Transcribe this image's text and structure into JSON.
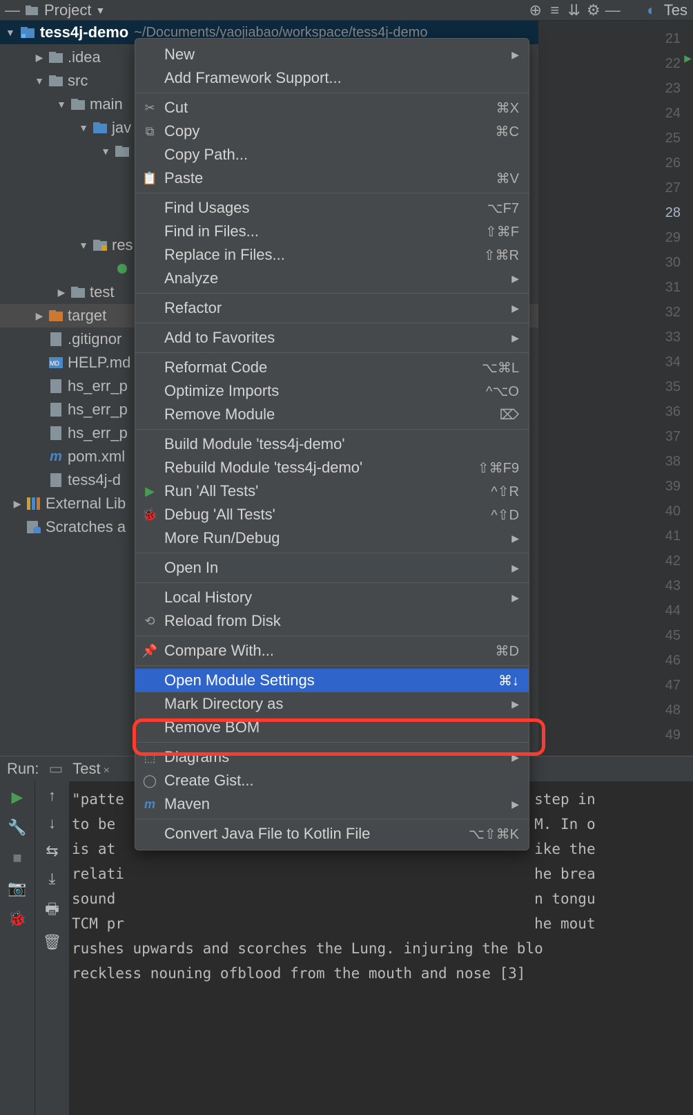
{
  "toolbar": {
    "project_label": "Project",
    "right_tab": "Tes"
  },
  "project_tree": {
    "root_name": "tess4j-demo",
    "root_path": "~/Documents/yaojiabao/workspace/tess4j-demo",
    "items": [
      {
        "label": ".idea",
        "depth": 1,
        "arrow": "right",
        "icon": "folder"
      },
      {
        "label": "src",
        "depth": 1,
        "arrow": "down",
        "icon": "folder"
      },
      {
        "label": "main",
        "depth": 2,
        "arrow": "down",
        "icon": "folder"
      },
      {
        "label": "jav",
        "depth": 3,
        "arrow": "down",
        "icon": "folder-blue"
      },
      {
        "label": "",
        "depth": 4,
        "arrow": "down",
        "icon": "folder"
      },
      {
        "label": "",
        "depth": 5,
        "arrow": "",
        "icon": ""
      },
      {
        "label": "",
        "depth": 5,
        "arrow": "",
        "icon": ""
      },
      {
        "label": "",
        "depth": 5,
        "arrow": "",
        "icon": ""
      },
      {
        "label": "res",
        "depth": 3,
        "arrow": "down",
        "icon": "folder-res"
      },
      {
        "label": "",
        "depth": 4,
        "arrow": "",
        "icon": "file-green"
      },
      {
        "label": "test",
        "depth": 2,
        "arrow": "right",
        "icon": "folder"
      },
      {
        "label": "target",
        "depth": 1,
        "arrow": "right",
        "icon": "folder-orange",
        "selected": true
      },
      {
        "label": ".gitignor",
        "depth": 1,
        "arrow": "",
        "icon": "file"
      },
      {
        "label": "HELP.md",
        "depth": 1,
        "arrow": "",
        "icon": "file-md"
      },
      {
        "label": "hs_err_p",
        "depth": 1,
        "arrow": "",
        "icon": "file"
      },
      {
        "label": "hs_err_p",
        "depth": 1,
        "arrow": "",
        "icon": "file"
      },
      {
        "label": "hs_err_p",
        "depth": 1,
        "arrow": "",
        "icon": "file"
      },
      {
        "label": "pom.xml",
        "depth": 1,
        "arrow": "",
        "icon": "file-maven"
      },
      {
        "label": "tess4j-d",
        "depth": 1,
        "arrow": "",
        "icon": "file"
      },
      {
        "label": "External Lib",
        "depth": 0,
        "arrow": "right",
        "icon": "lib"
      },
      {
        "label": "Scratches a",
        "depth": 0,
        "arrow": "",
        "icon": "scratch"
      }
    ]
  },
  "gutter": {
    "start": 21,
    "end": 49,
    "current": 28,
    "play_at": 22
  },
  "context_menu": {
    "groups": [
      [
        {
          "label": "New",
          "arrow": true
        },
        {
          "label": "Add Framework Support..."
        }
      ],
      [
        {
          "icon": "cut",
          "label": "Cut",
          "shortcut": "⌘X"
        },
        {
          "icon": "copy",
          "label": "Copy",
          "shortcut": "⌘C"
        },
        {
          "label": "Copy Path..."
        },
        {
          "icon": "paste",
          "label": "Paste",
          "shortcut": "⌘V"
        }
      ],
      [
        {
          "label": "Find Usages",
          "shortcut": "⌥F7"
        },
        {
          "label": "Find in Files...",
          "shortcut": "⇧⌘F"
        },
        {
          "label": "Replace in Files...",
          "shortcut": "⇧⌘R"
        },
        {
          "label": "Analyze",
          "arrow": true
        }
      ],
      [
        {
          "label": "Refactor",
          "arrow": true
        }
      ],
      [
        {
          "label": "Add to Favorites",
          "arrow": true
        }
      ],
      [
        {
          "label": "Reformat Code",
          "shortcut": "⌥⌘L"
        },
        {
          "label": "Optimize Imports",
          "shortcut": "^⌥O"
        },
        {
          "label": "Remove Module",
          "shortcut": "⌦"
        }
      ],
      [
        {
          "label": "Build Module 'tess4j-demo'"
        },
        {
          "label": "Rebuild Module 'tess4j-demo'",
          "shortcut": "⇧⌘F9"
        },
        {
          "icon": "run",
          "label": "Run 'All Tests'",
          "shortcut": "^⇧R"
        },
        {
          "icon": "debug",
          "label": "Debug 'All Tests'",
          "shortcut": "^⇧D"
        },
        {
          "label": "More Run/Debug",
          "arrow": true
        }
      ],
      [
        {
          "label": "Open In",
          "arrow": true
        }
      ],
      [
        {
          "label": "Local History",
          "arrow": true
        },
        {
          "icon": "reload",
          "label": "Reload from Disk"
        }
      ],
      [
        {
          "icon": "pin",
          "label": "Compare With...",
          "shortcut": "⌘D"
        }
      ],
      [
        {
          "label": "Open Module Settings",
          "shortcut": "⌘↓",
          "highlighted": true
        },
        {
          "label": "Mark Directory as",
          "arrow": true
        },
        {
          "label": "Remove BOM"
        }
      ],
      [
        {
          "icon": "diagram",
          "label": "Diagrams",
          "arrow": true
        },
        {
          "icon": "github",
          "label": "Create Gist..."
        },
        {
          "icon": "maven",
          "label": "Maven",
          "arrow": true
        }
      ],
      [
        {
          "label": "Convert Java File to Kotlin File",
          "shortcut": "⌥⇧⌘K"
        }
      ]
    ]
  },
  "run_panel": {
    "label": "Run:",
    "tab": "Test",
    "console_lines": [
      "\"patte                                               step in",
      "to be                                                M. In o",
      "is at                                                ike the",
      "relati                                               he brea",
      "sound                                                n tongu",
      "TCM pr                                               he mout",
      "rushes upwards and scorches the Lung. injuring the blo",
      "reckless nouning ofblood from the mouth and nose [3]"
    ]
  }
}
